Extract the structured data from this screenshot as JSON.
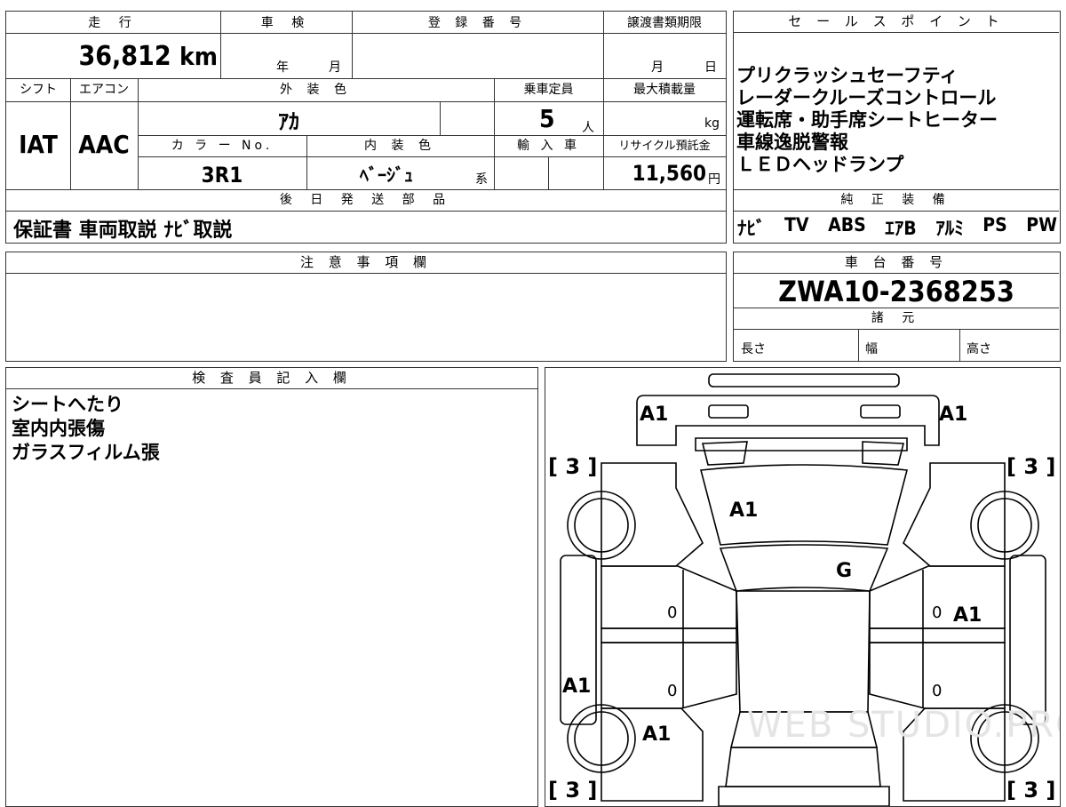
{
  "top_info": {
    "mileage_label": "走 行",
    "mileage_value": "36,812",
    "mileage_unit": "km",
    "inspection_label": "車 検",
    "inspection_year_unit": "年",
    "inspection_month_unit": "月",
    "registration_label": "登 録 番 号",
    "transfer_label": "譲渡書類期限",
    "transfer_month_unit": "月",
    "transfer_day_unit": "日",
    "shift_label": "シフト",
    "shift_value": "IAT",
    "aircon_label": "エアコン",
    "aircon_value": "AAC",
    "exterior_color_label": "外 装 色",
    "exterior_color_value": "ｱｶ",
    "capacity_label": "乗車定員",
    "capacity_value": "5",
    "capacity_unit": "人",
    "max_load_label": "最大積載量",
    "max_load_unit": "kg",
    "color_no_label": "カ ラ ー No.",
    "color_no_value": "3R1",
    "interior_color_label": "内 装 色",
    "interior_color_value": "ﾍﾞｰｼﾞｭ",
    "interior_color_suffix": "系",
    "import_label": "輸 入 車",
    "recycle_label": "リサイクル預託金",
    "recycle_value": "11,560",
    "recycle_unit": "円"
  },
  "later_parts": {
    "label": "後 日 発 送 部 品",
    "value": "保証書 車両取説 ﾅﾋﾞ取説"
  },
  "sales_points": {
    "label": "セ ー ル ス ポ イ ン ト",
    "lines": [
      "プリクラッシュセーフティ",
      "レーダークルーズコントロール",
      "運転席・助手席シートヒーター",
      "車線逸脱警報",
      "ＬＥＤヘッドランプ"
    ]
  },
  "genuine_equipment": {
    "label": "純 正 装 備",
    "items": [
      "ﾅﾋﾞ",
      "TV",
      "ABS",
      "ｴｱB",
      "ｱﾙﾐ",
      "PS",
      "PW"
    ]
  },
  "notes": {
    "label": "注 意 事 項 欄"
  },
  "chassis": {
    "label": "車 台 番 号",
    "value": "ZWA10-2368253"
  },
  "specs": {
    "label": "諸 元",
    "length_label": "長さ",
    "width_label": "幅",
    "height_label": "高さ"
  },
  "inspector": {
    "label": "検 査 員 記 入 欄",
    "lines": [
      "シートへたり",
      "室内内張傷",
      "ガラスフィルム張"
    ]
  },
  "diagram": {
    "marks": {
      "front_left": "A1",
      "front_right": "A1",
      "hood": "A1",
      "windshield": "G",
      "right_front_door": "A1",
      "left_rear_fender": "A1",
      "left_rear_door": "A1",
      "zero_1": "0",
      "zero_2": "0",
      "zero_3": "0",
      "zero_4": "0"
    },
    "tire_label": "[ 3 ]",
    "watermark": "WEB STUDIO.PRO"
  }
}
